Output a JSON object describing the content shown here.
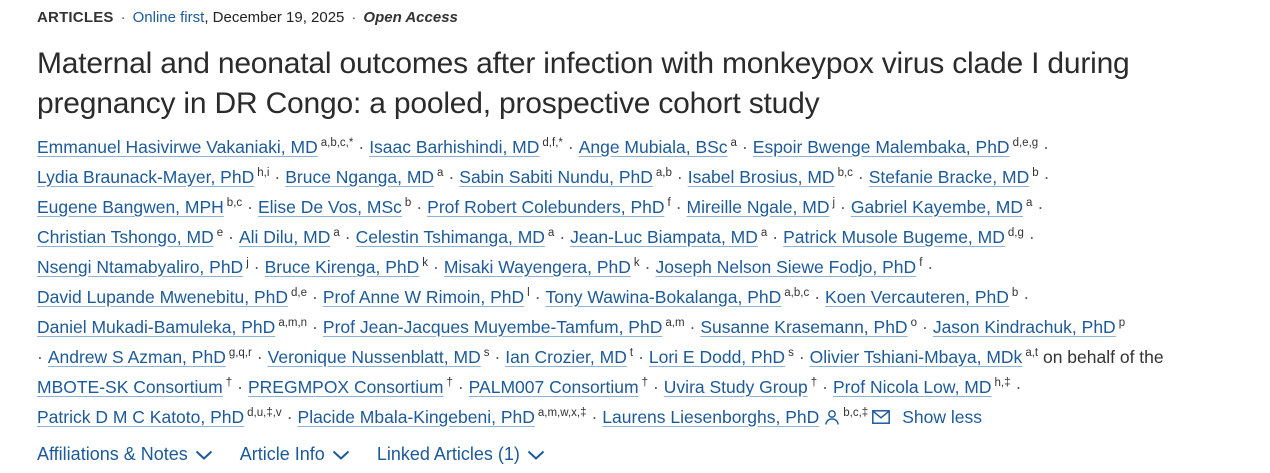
{
  "meta": {
    "article_type": "ARTICLES",
    "online_first": "Online first",
    "date": ", December 19, 2025",
    "open_access": "Open Access"
  },
  "title": "Maternal and neonatal outcomes after infection with monkeypox virus clade I during pregnancy in DR Congo: a pooled, prospective cohort study",
  "authors": [
    {
      "name": "Emmanuel Hasivirwe Vakaniaki, MD",
      "aff": "a,b,c,*"
    },
    {
      "name": "Isaac Barhishindi, MD",
      "aff": "d,f,*"
    },
    {
      "name": "Ange Mubiala, BSc",
      "aff": "a"
    },
    {
      "name": "Espoir Bwenge Malembaka, PhD",
      "aff": "d,e,g"
    },
    {
      "name": "Lydia Braunack-Mayer, PhD",
      "aff": "h,i"
    },
    {
      "name": "Bruce Nganga, MD",
      "aff": "a"
    },
    {
      "name": "Sabin Sabiti Nundu, PhD",
      "aff": "a,b"
    },
    {
      "name": "Isabel Brosius, MD",
      "aff": "b,c"
    },
    {
      "name": "Stefanie Bracke, MD",
      "aff": "b"
    },
    {
      "name": "Eugene Bangwen, MPH",
      "aff": "b,c"
    },
    {
      "name": "Elise De Vos, MSc",
      "aff": "b"
    },
    {
      "name": "Prof Robert Colebunders, PhD",
      "aff": "f"
    },
    {
      "name": "Mireille Ngale, MD",
      "aff": "j"
    },
    {
      "name": "Gabriel Kayembe, MD",
      "aff": "a"
    },
    {
      "name": "Christian Tshongo, MD",
      "aff": "e"
    },
    {
      "name": "Ali Dilu, MD",
      "aff": "a"
    },
    {
      "name": "Celestin Tshimanga, MD",
      "aff": "a"
    },
    {
      "name": "Jean-Luc Biampata, MD",
      "aff": "a"
    },
    {
      "name": "Patrick Musole Bugeme, MD",
      "aff": "d,g"
    },
    {
      "name": "Nsengi Ntamabyaliro, PhD",
      "aff": "j"
    },
    {
      "name": "Bruce Kirenga, PhD",
      "aff": "k"
    },
    {
      "name": "Misaki Wayengera, PhD",
      "aff": "k"
    },
    {
      "name": "Joseph Nelson Siewe Fodjo, PhD",
      "aff": "f"
    },
    {
      "name": "David Lupande Mwenebitu, PhD",
      "aff": "d,e"
    },
    {
      "name": "Prof Anne W Rimoin, PhD",
      "aff": "l"
    },
    {
      "name": "Tony Wawina-Bokalanga, PhD",
      "aff": "a,b,c"
    },
    {
      "name": "Koen Vercauteren, PhD",
      "aff": "b"
    },
    {
      "name": "Daniel Mukadi-Bamuleka, PhD",
      "aff": "a,m,n"
    },
    {
      "name": "Prof Jean-Jacques Muyembe-Tamfum, PhD",
      "aff": "a,m"
    },
    {
      "name": "Susanne Krasemann, PhD",
      "aff": "o"
    },
    {
      "name": "Jason Kindrachuk, PhD",
      "aff": "p"
    },
    {
      "name": "Andrew S Azman, PhD",
      "aff": "g,q,r"
    },
    {
      "name": "Veronique Nussenblatt, MD",
      "aff": "s"
    },
    {
      "name": "Ian Crozier, MD",
      "aff": "t"
    },
    {
      "name": "Lori E Dodd, PhD",
      "aff": "s"
    },
    {
      "name": "Olivier Tshiani-Mbaya, MDk",
      "aff": "a,t"
    },
    {
      "name": "MBOTE-SK Consortium",
      "aff": "†"
    },
    {
      "name": "PREGMPOX Consortium",
      "aff": "†"
    },
    {
      "name": "PALM007 Consortium",
      "aff": "†"
    },
    {
      "name": "Uvira Study Group",
      "aff": "†"
    },
    {
      "name": "Prof Nicola Low, MD",
      "aff": "h,‡"
    },
    {
      "name": "Patrick D M C Katoto, PhD",
      "aff": "d,u,‡,v"
    },
    {
      "name": "Placide Mbala-Kingebeni, PhD",
      "aff": "a,m,w,x,‡"
    },
    {
      "name": "Laurens Liesenborghs, PhD",
      "aff": "b,c,‡"
    }
  ],
  "behalf_text": "on behalf of the",
  "separator": "·",
  "show_less": "Show less",
  "icons": {
    "corresponding": "person-icon",
    "email": "mail-icon",
    "expand": "chevron-down-icon"
  },
  "tabs": [
    {
      "label": "Affiliations & Notes"
    },
    {
      "label": "Article Info"
    },
    {
      "label": "Linked Articles (1)"
    }
  ],
  "colors": {
    "link": "#1c5a9a",
    "text": "#333333"
  }
}
